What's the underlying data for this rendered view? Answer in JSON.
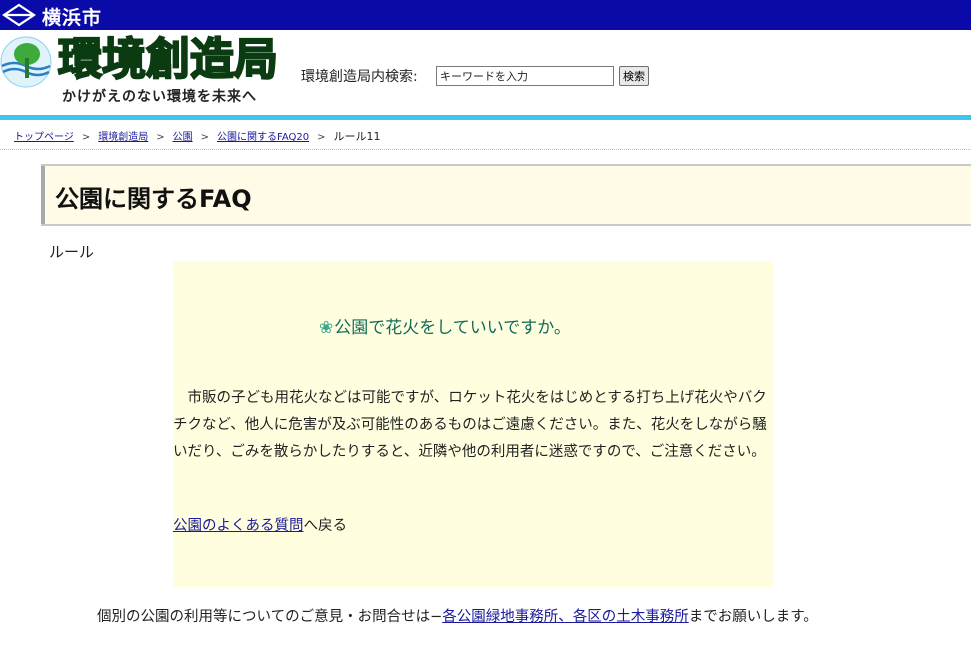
{
  "city_bar": {
    "name": "横浜市"
  },
  "header": {
    "bureau_name": "環境創造局",
    "tagline": "かけがえのない環境を未来へ",
    "search_label": "環境創造局内検索:",
    "search_value": "キーワードを入力",
    "search_button": "検索"
  },
  "breadcrumb": {
    "items": [
      "トップページ",
      "環境創造局",
      "公園",
      "公園に関するFAQ20"
    ],
    "separator": ">",
    "current": "ルール11"
  },
  "page": {
    "title": "公園に関するFAQ",
    "section_label": "ルール"
  },
  "faq": {
    "question_mark": "❀",
    "question": "公園で花火をしていいですか。",
    "answer": "市販の子ども用花火などは可能ですが、ロケット花火をはじめとする打ち上げ花火やバクチクなど、他人に危害が及ぶ可能性のあるものはご遠慮ください。また、花火をしながら騒いだり、ごみを散らかしたりすると、近隣や他の利用者に迷惑ですので、ご注意ください。",
    "back_link": "公園のよくある質問",
    "back_suffix": "へ戻る"
  },
  "contact": {
    "prefix": "個別の公園の利用等についてのご意見・お問合せは−",
    "link": "各公園緑地事務所、各区の土木事務所",
    "suffix": "までお願いします。"
  },
  "colors": {
    "city_bar": "#0a0aa8",
    "accent_rule": "#3ec5ee",
    "title_bg": "#fffbe6",
    "faq_bg": "#ffffe0",
    "question_text": "#136b5a",
    "link": "#1a1a9a"
  },
  "icons": {
    "city_logo": "yokohama-logo-icon",
    "bureau_emblem": "tree-emblem-icon",
    "question_mark": "clover-icon"
  }
}
